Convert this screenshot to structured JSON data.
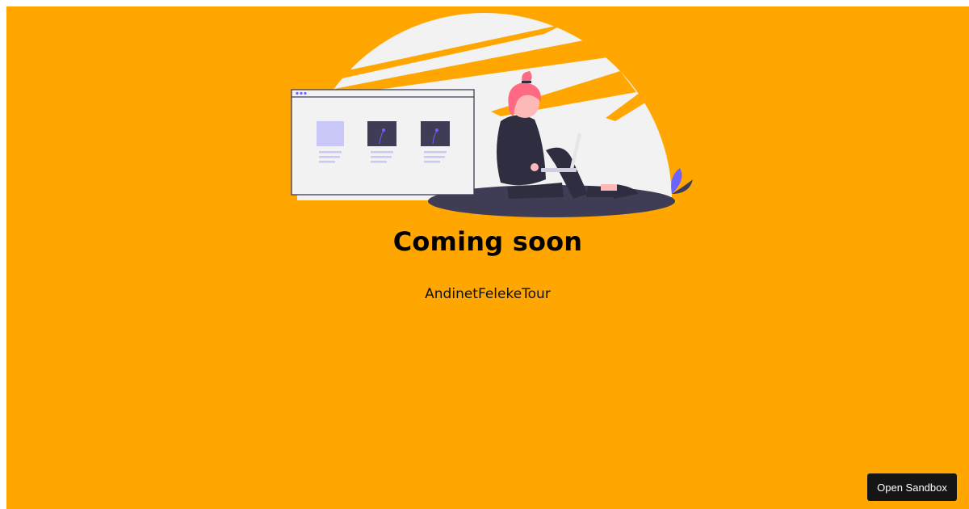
{
  "page": {
    "background_color": "#ffa600"
  },
  "illustration": {
    "icon": "person-with-laptop-illustration"
  },
  "heading": {
    "title": "Coming soon",
    "subtitle": "AndinetFelekeTour"
  },
  "sandbox": {
    "button_label": "Open Sandbox",
    "button_color": "#151515"
  }
}
